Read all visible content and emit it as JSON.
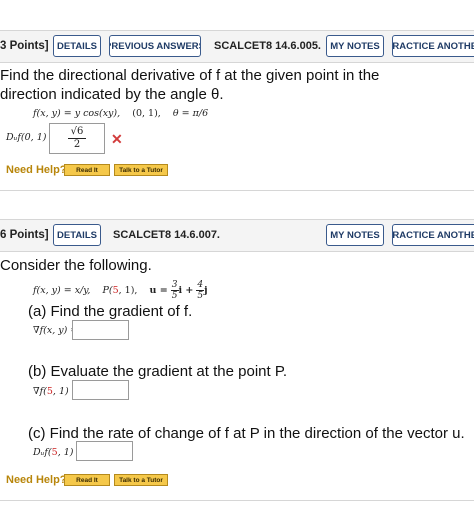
{
  "p1": {
    "points": "3 Points]",
    "details": "DETAILS",
    "previous": "PREVIOUS ANSWERS",
    "code": "SCALCET8 14.6.005.",
    "my_notes": "MY NOTES",
    "practice": "PRACTICE ANOTHER",
    "question": "Find the directional derivative of f at the given point in the direction indicated by the angle θ.",
    "function": "f(x, y) = y cos(xy),",
    "point": "(0, 1),",
    "angle": "θ = π/6",
    "answer_label": "Dᵤf(0, 1) =",
    "answer_num": "√6",
    "answer_den": "2",
    "wrong_mark": "✕",
    "need_help": "Need Help?",
    "read_it": "Read It",
    "talk": "Talk to a Tutor"
  },
  "p2": {
    "points": "6 Points]",
    "details": "DETAILS",
    "code": "SCALCET8 14.6.007.",
    "my_notes": "MY NOTES",
    "practice": "PRACTICE ANOTHER",
    "question": "Consider the following.",
    "function": "f(x, y) = x/y,",
    "point_pre": "P(",
    "point_x": "5",
    "point_mid": ", 1),",
    "u_label": "u =",
    "u_n1": "3",
    "u_d1": "5",
    "u_i": "i +",
    "u_n2": "4",
    "u_d2": "5",
    "u_j": "j",
    "part_a": "(a) Find the gradient of f.",
    "part_a_label": "∇f(x, y) =",
    "part_b": "(b) Evaluate the gradient at the point P.",
    "part_b_label_pre": "∇f(",
    "part_b_x": "5",
    "part_b_label_post": ", 1) =",
    "part_c": "(c) Find the rate of change of f at P in the direction of the vector u.",
    "part_c_label_pre": "Dᵤf(",
    "part_c_x": "5",
    "part_c_label_post": ", 1) =",
    "need_help": "Need Help?",
    "read_it": "Read It",
    "talk": "Talk to a Tutor"
  }
}
